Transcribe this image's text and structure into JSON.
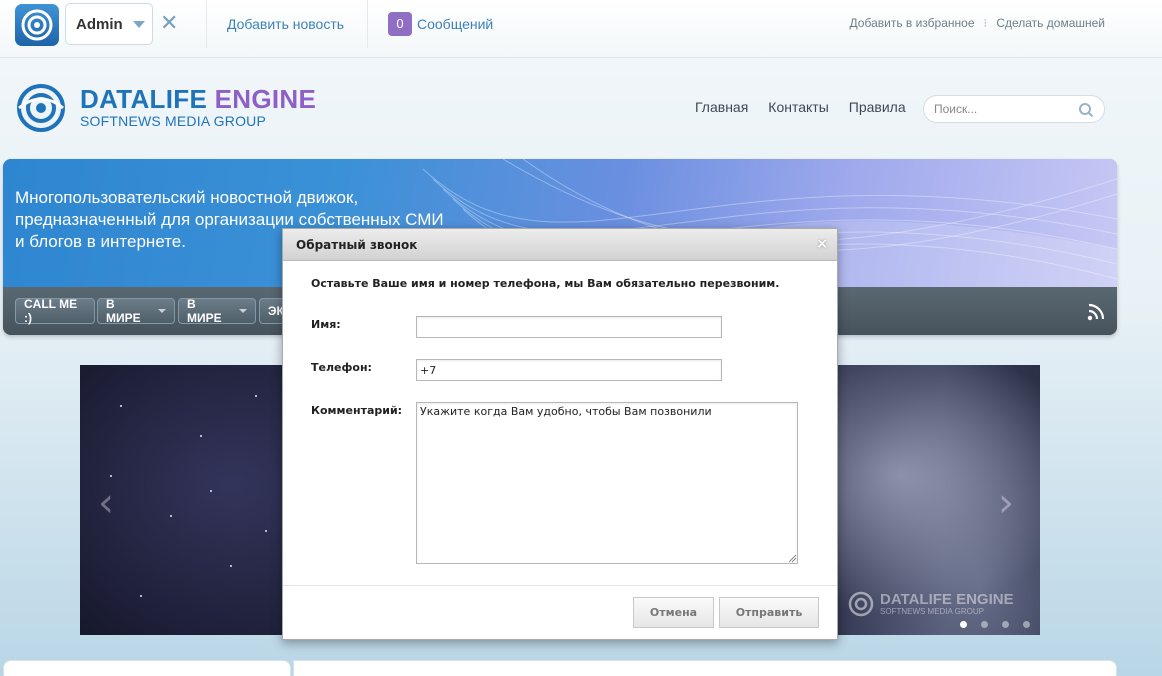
{
  "topbar": {
    "username": "Admin",
    "add_news": "Добавить новость",
    "messages_count": "0",
    "messages_label": "Сообщений",
    "add_favorites": "Добавить в избранное",
    "set_home": "Сделать домашней"
  },
  "header": {
    "brand_part1": "DATALIFE",
    "brand_part2": "ENGINE",
    "brand_sub": "SOFTNEWS MEDIA GROUP",
    "nav": [
      "Главная",
      "Контакты",
      "Правила"
    ],
    "search_placeholder": "Поиск..."
  },
  "banner": {
    "text": "Многопользовательский новостной движок, предназначенный для организации собственных СМИ и блогов в интернете.",
    "buttons": [
      {
        "label": "CALL ME :)"
      },
      {
        "label": "В МИРЕ"
      },
      {
        "label": "В МИРЕ"
      },
      {
        "label": "ЭК"
      }
    ]
  },
  "slider": {
    "prev": "‹",
    "next": "›",
    "watermark_title": "DATALIFE ENGINE",
    "watermark_sub": "SOFTNEWS MEDIA GROUP",
    "active_dot": 0
  },
  "dialog": {
    "title": "Обратный звонок",
    "close": "×",
    "intro": "Оставьте Ваше имя и номер телефона, мы Вам обязательно перезвоним.",
    "name_label": "Имя:",
    "name_value": "",
    "phone_label": "Телефон:",
    "phone_value": "+7",
    "comment_label": "Комментарий:",
    "comment_value": "Укажите когда Вам удобно, чтобы Вам позвонили",
    "cancel": "Отмена",
    "submit": "Отправить"
  },
  "colors": {
    "brand_blue": "#1f74b9",
    "brand_purple": "#8d5fc7",
    "link_blue": "#3b82b8",
    "message_badge": "#8e6fc4"
  }
}
